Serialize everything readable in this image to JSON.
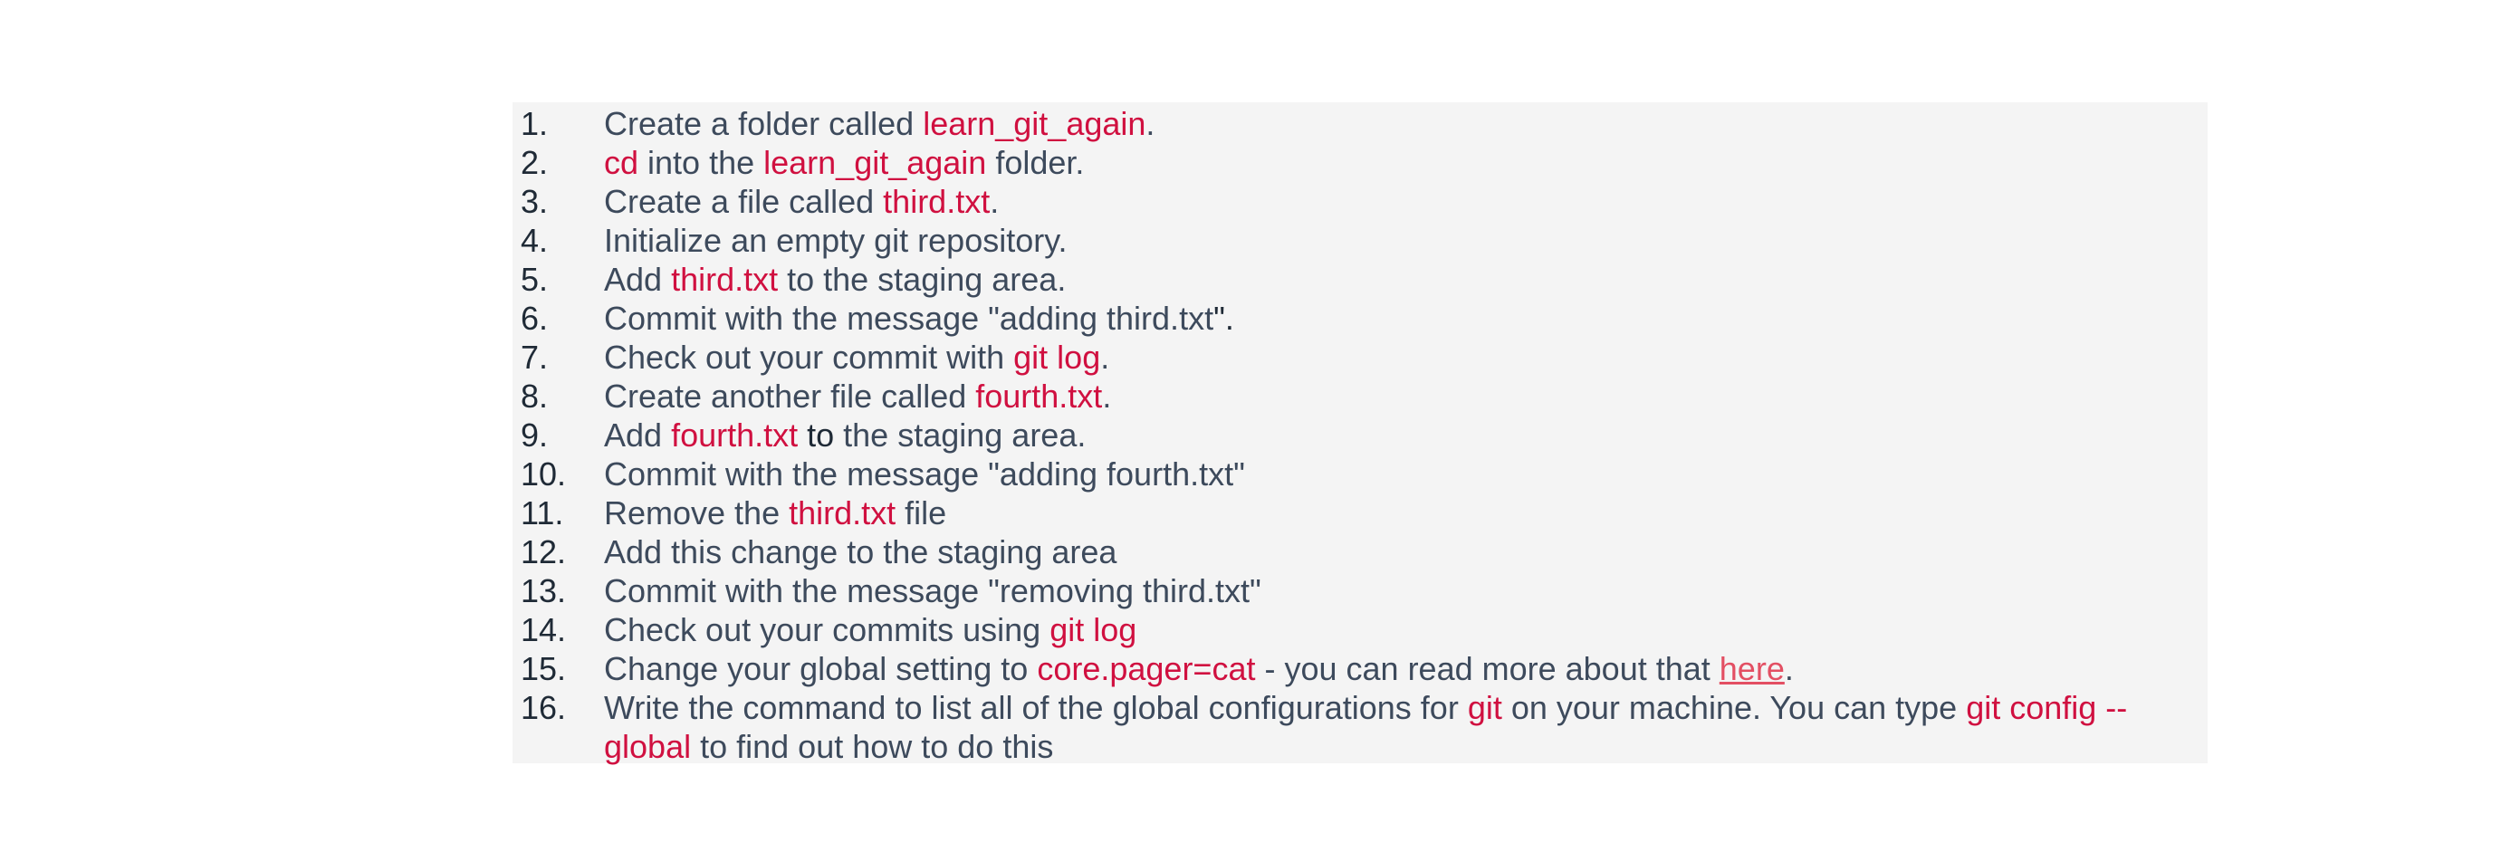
{
  "items": [
    {
      "n": "1.",
      "segments": [
        {
          "t": "Create a folder called "
        },
        {
          "t": "learn_git_again",
          "s": "code"
        },
        {
          "t": "."
        }
      ]
    },
    {
      "n": "2.",
      "segments": [
        {
          "t": "cd",
          "s": "code"
        },
        {
          "t": " into the "
        },
        {
          "t": "learn_git_again",
          "s": "code"
        },
        {
          "t": " folder."
        }
      ]
    },
    {
      "n": "3.",
      "segments": [
        {
          "t": "Create a file called "
        },
        {
          "t": "third.txt",
          "s": "code"
        },
        {
          "t": "."
        }
      ]
    },
    {
      "n": "4.",
      "segments": [
        {
          "t": "Initialize an empty git repository."
        }
      ]
    },
    {
      "n": "5.",
      "segments": [
        {
          "t": "Add "
        },
        {
          "t": "third.txt",
          "s": "code"
        },
        {
          "t": " to the staging area."
        }
      ]
    },
    {
      "n": "6.",
      "segments": [
        {
          "t": "Commit with the message \"adding third.txt"
        },
        {
          "t": "\".",
          "s": "dark"
        }
      ]
    },
    {
      "n": "7.",
      "segments": [
        {
          "t": "Check out your commit with "
        },
        {
          "t": "git log",
          "s": "code"
        },
        {
          "t": "."
        }
      ]
    },
    {
      "n": "8.",
      "segments": [
        {
          "t": "Create another file called "
        },
        {
          "t": "fourth.txt",
          "s": "code"
        },
        {
          "t": "."
        }
      ]
    },
    {
      "n": "9.",
      "segments": [
        {
          "t": "Add "
        },
        {
          "t": "fourth.txt",
          "s": "code"
        },
        {
          "t": " to",
          "s": "dark"
        },
        {
          "t": " the staging area."
        }
      ]
    },
    {
      "n": "10.",
      "segments": [
        {
          "t": "Commit with the message \"adding fourth.txt\""
        }
      ]
    },
    {
      "n": "11.",
      "segments": [
        {
          "t": "Remove the "
        },
        {
          "t": "third.txt",
          "s": "code"
        },
        {
          "t": " file"
        }
      ]
    },
    {
      "n": "12.",
      "segments": [
        {
          "t": "Add this change to the staging area"
        }
      ]
    },
    {
      "n": "13.",
      "segments": [
        {
          "t": "Commit with the message \"removing third.txt\""
        }
      ]
    },
    {
      "n": "14.",
      "segments": [
        {
          "t": "Check out your commits using "
        },
        {
          "t": "git log",
          "s": "code"
        }
      ]
    },
    {
      "n": "15.",
      "segments": [
        {
          "t": "Change your global setting to "
        },
        {
          "t": "core.pager=cat",
          "s": "code"
        },
        {
          "t": " - you can read more about that "
        },
        {
          "t": "here",
          "s": "link"
        },
        {
          "t": "."
        }
      ]
    },
    {
      "n": "16.",
      "segments": [
        {
          "t": "Write the command to list all of the global configurations for "
        },
        {
          "t": "git",
          "s": "code"
        },
        {
          "t": " on your machine. You can type "
        },
        {
          "t": "git config --global",
          "s": "code"
        },
        {
          "t": " to find out how to do this"
        }
      ]
    }
  ],
  "colors": {
    "text": "#3d4a5c",
    "number": "#1f2a36",
    "code": "#d01040",
    "link": "#e34f63",
    "panel_background": "#f4f4f4"
  }
}
